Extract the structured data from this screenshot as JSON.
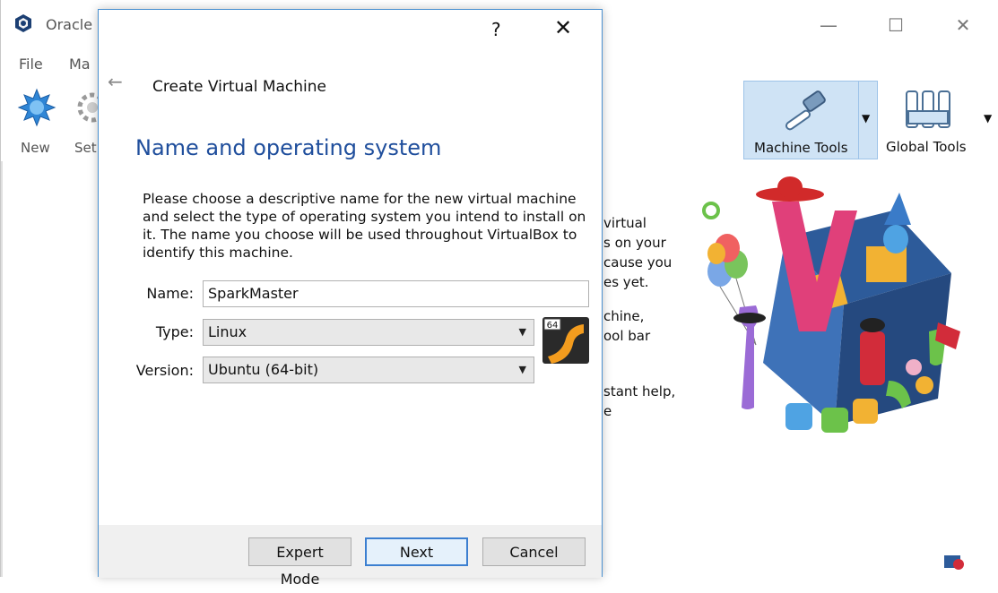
{
  "main_window": {
    "title": "Oracle",
    "minimize": "—",
    "maximize": "☐",
    "close": "✕",
    "menu": [
      "File",
      "Ma"
    ],
    "toolbar": {
      "new_label": "New",
      "settings_label": "Set"
    },
    "machine_tools_label": "Machine Tools",
    "global_tools_label": "Global Tools",
    "welcome_fragments": [
      "virtual",
      "s on your",
      "cause you",
      "es yet.",
      "chine,",
      "ool bar",
      "stant help,",
      "e"
    ]
  },
  "dialog": {
    "help_label": "?",
    "close_label": "✕",
    "back_label": "←",
    "title": "Create Virtual Machine",
    "heading": "Name and operating system",
    "description": "Please choose a descriptive name for the new virtual machine and select the type of operating system you intend to install on it. The name you choose will be used throughout VirtualBox to identify this machine.",
    "name_label": "Name:",
    "name_value": "SparkMaster",
    "type_label": "Type:",
    "type_value": "Linux",
    "version_label": "Version:",
    "version_value": "Ubuntu (64-bit)",
    "os_badge": "64",
    "buttons": {
      "expert": "Expert Mode",
      "next": "Next",
      "cancel": "Cancel"
    }
  },
  "colors": {
    "heading": "#1f4e9c",
    "accent": "#3c7fd0",
    "tool_selected": "#cfe3f5"
  }
}
